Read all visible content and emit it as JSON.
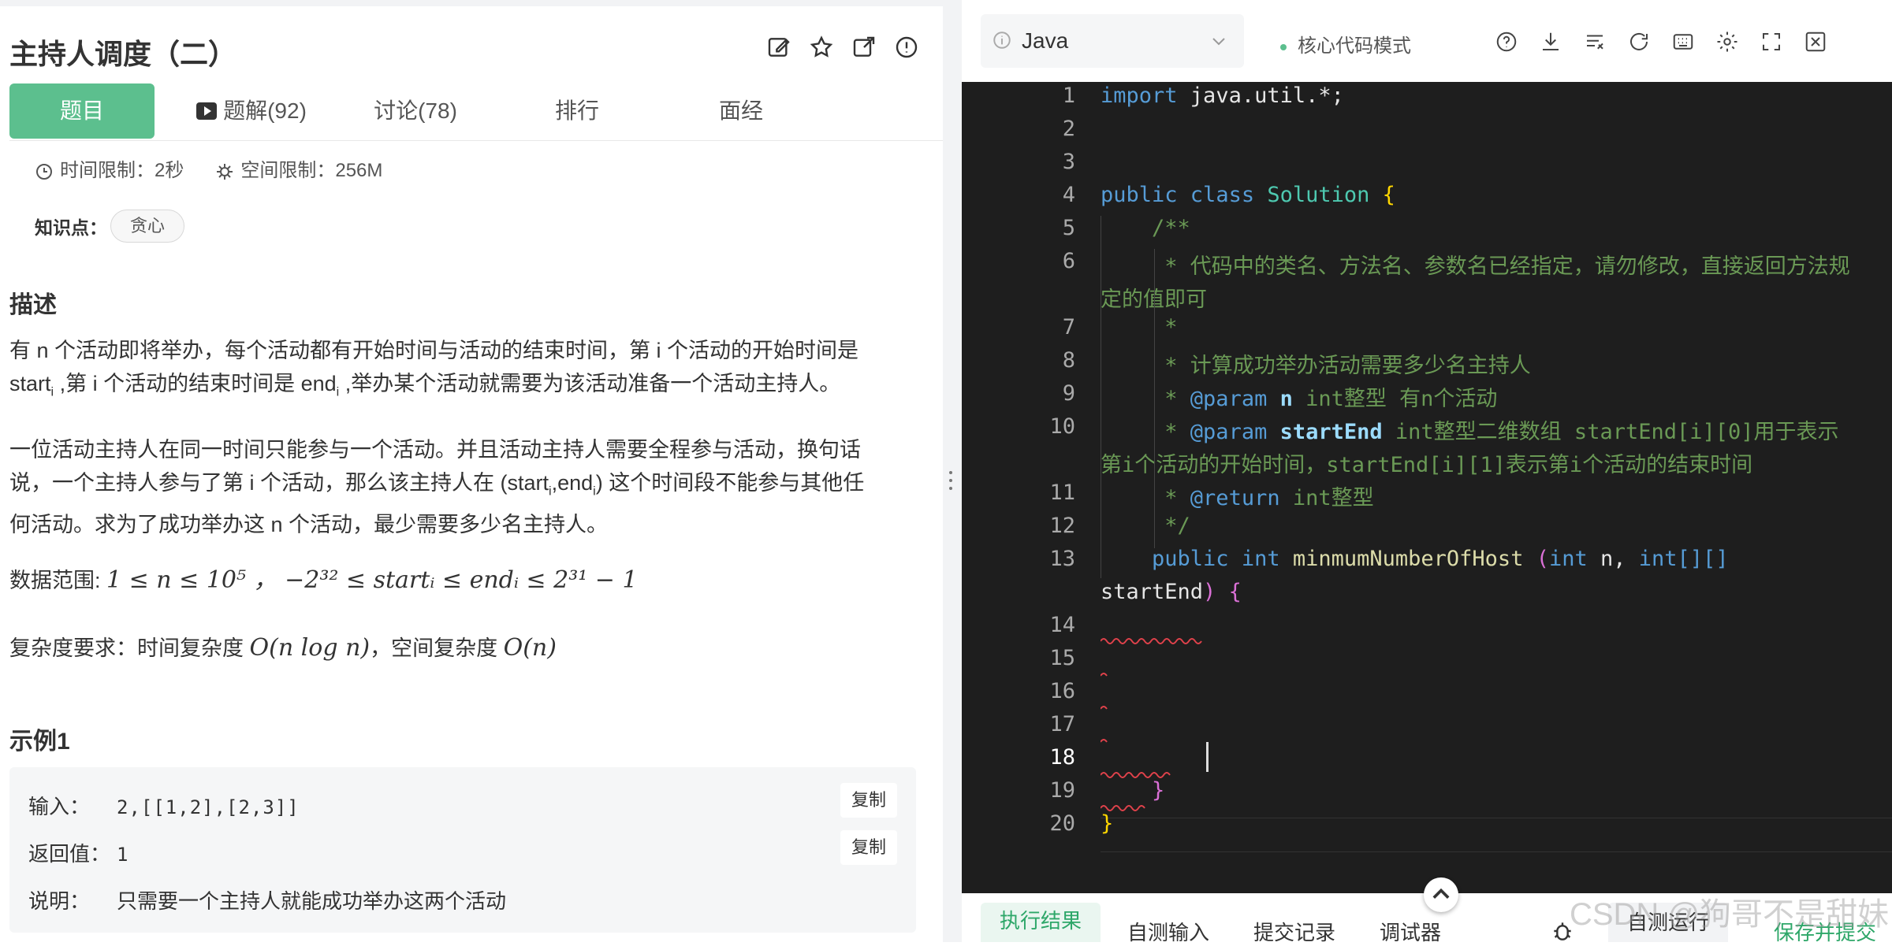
{
  "problem": {
    "title": "主持人调度（二）",
    "tabs": [
      "题目",
      "题解(92)",
      "讨论(78)",
      "排行",
      "面经"
    ],
    "time_limit": "时间限制：2秒",
    "space_limit": "空间限制：256M",
    "knowledge_label": "知识点：",
    "knowledge_tag": "贪心",
    "desc_heading": "描述",
    "desc_p1_a": "有 n 个活动即将举办，每个活动都有开始时间与活动的结束时间，第 i 个活动的开始时间是",
    "desc_p1_b1": "start",
    "desc_p1_b2": "i",
    "desc_p1_b3": " ,第 i 个活动的结束时间是 end",
    "desc_p1_b4": "i",
    "desc_p1_b5": " ,举办某个活动就需要为该活动准备一个活动主持人。",
    "desc_p2_a": "一位活动主持人在同一时间只能参与一个活动。并且活动主持人需要全程参与活动，换句话",
    "desc_p2_b": "说，一个主持人参与了第 i 个活动，那么该主持人在 (start",
    "desc_p2_c": "i",
    "desc_p2_d": ",end",
    "desc_p2_e": "i",
    "desc_p2_f": ") 这个时间段不能参与其他任",
    "desc_p2_g": "何活动。求为了成功举办这 n 个活动，最少需要多少名主持人。",
    "range_label": "数据范围: ",
    "range_math": "1 ≤ n ≤ 10⁵ ，  −2³² ≤ startᵢ ≤ endᵢ ≤ 2³¹ − 1",
    "complexity_a": "复杂度要求：时间复杂度 ",
    "complexity_time": "O(n log n)",
    "complexity_b": "，空间复杂度 ",
    "complexity_space": "O(n)",
    "example_heading": "示例1",
    "example": {
      "input_label": "输入：",
      "input_value": "2,[[1,2],[2,3]]",
      "return_label": "返回值：",
      "return_value": "1",
      "explain_label": "说明：",
      "explain_value": "只需要一个主持人就能成功举办这两个活动",
      "copy_label": "复制"
    }
  },
  "editor": {
    "language": "Java",
    "mode": "核心代码模式",
    "line_numbers": [
      "1",
      "2",
      "3",
      "4",
      "5",
      "6",
      "7",
      "8",
      "9",
      "10",
      "11",
      "12",
      "13",
      "14",
      "15",
      "16",
      "17",
      "18",
      "19",
      "20"
    ],
    "current_line": "18",
    "code": {
      "l1_kw": "import",
      "l1_rest": " java.util.*;",
      "l4_kw1": "public",
      "l4_kw2": " class",
      "l4_cls": " Solution",
      "l4_br": " {",
      "l5": "    /**",
      "l6a": "     * 代码中的类名、方法名、参数名已经指定，请勿修改，直接返回方法规",
      "l6b": "定的值即可",
      "l7": "     *",
      "l8": "     * 计算成功举办活动需要多少名主持人",
      "l9_pre": "     * ",
      "l9_tag": "@param",
      "l9_name": " n",
      "l9_rest": " int整型 有n个活动",
      "l10_pre": "     * ",
      "l10_tag": "@param",
      "l10_name": " startEnd",
      "l10_rest": " int整型二维数组 startEnd[i][0]用于表示",
      "l10b": "第i个活动的开始时间，startEnd[i][1]表示第i个活动的结束时间",
      "l11_pre": "     * ",
      "l11_tag": "@return",
      "l11_rest": " int整型",
      "l12": "     */",
      "l13_kw1": "    public",
      "l13_kw2": " int",
      "l13_fn": " minmumNumberOfHost",
      "l13_p": " (",
      "l13_kw3": "int",
      "l13_r1": " n, ",
      "l13_kw4": "int[][]",
      "l13b_name": "startEnd",
      "l13b_p": ")",
      "l13b_br": " {",
      "l19": "    }",
      "l20": "}"
    }
  },
  "bottom_tabs": [
    "执行结果",
    "自测输入",
    "提交记录",
    "调试器",
    "自测运行",
    "保存并提交"
  ],
  "watermark": "CSDN @狗哥不是甜妹"
}
